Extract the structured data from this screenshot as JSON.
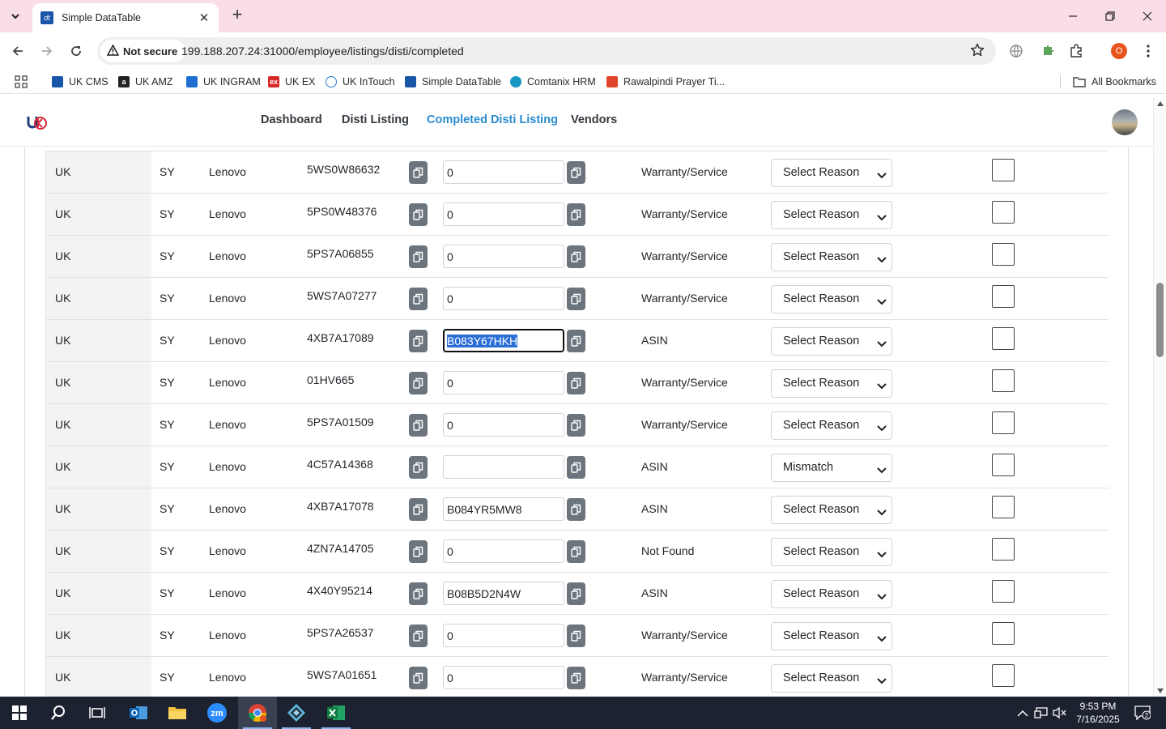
{
  "browser": {
    "tab_title": "Simple DataTable",
    "security_label": "Not secure",
    "url": "199.188.207.24:31000/employee/listings/disti/completed",
    "profile_initial": "O"
  },
  "bookmarks": [
    {
      "label": "UK CMS",
      "color": "#1a56a8",
      "icon": "uk-cms-icon"
    },
    {
      "label": "UK AMZ",
      "color": "#222222",
      "icon": "amazon-icon"
    },
    {
      "label": "UK INGRAM",
      "color": "#1f6fd1",
      "icon": "ingram-icon"
    },
    {
      "label": "UK EX",
      "color": "#d62828",
      "icon": "ex-icon"
    },
    {
      "label": "UK InTouch",
      "color": "#2a7bd3",
      "icon": "intouch-icon"
    },
    {
      "label": "Simple DataTable",
      "color": "#1a56a8",
      "icon": "datatable-icon"
    },
    {
      "label": "Comtanix HRM",
      "color": "#1596c2",
      "icon": "hrm-icon"
    },
    {
      "label": "Rawalpindi Prayer Ti...",
      "color": "#e0452b",
      "icon": "prayer-icon"
    }
  ],
  "all_bookmarks_label": "All Bookmarks",
  "site_nav": {
    "links": [
      {
        "label": "Dashboard",
        "active": false
      },
      {
        "label": "Disti Listing",
        "active": false
      },
      {
        "label": "Completed Disti Listing",
        "active": true
      },
      {
        "label": "Vendors",
        "active": false
      }
    ]
  },
  "rows": [
    {
      "region": "UK",
      "code": "SY",
      "brand": "Lenovo",
      "part": "5WS0W86632",
      "asin": "0",
      "type": "Warranty/Service",
      "reason": "Select Reason"
    },
    {
      "region": "UK",
      "code": "SY",
      "brand": "Lenovo",
      "part": "5PS0W48376",
      "asin": "0",
      "type": "Warranty/Service",
      "reason": "Select Reason"
    },
    {
      "region": "UK",
      "code": "SY",
      "brand": "Lenovo",
      "part": "5PS7A06855",
      "asin": "0",
      "type": "Warranty/Service",
      "reason": "Select Reason"
    },
    {
      "region": "UK",
      "code": "SY",
      "brand": "Lenovo",
      "part": "5WS7A07277",
      "asin": "0",
      "type": "Warranty/Service",
      "reason": "Select Reason"
    },
    {
      "region": "UK",
      "code": "SY",
      "brand": "Lenovo",
      "part": "4XB7A17089",
      "asin": "B083Y67HKH",
      "type": "ASIN",
      "reason": "Select Reason",
      "focused": true
    },
    {
      "region": "UK",
      "code": "SY",
      "brand": "Lenovo",
      "part": "01HV665",
      "asin": "0",
      "type": "Warranty/Service",
      "reason": "Select Reason"
    },
    {
      "region": "UK",
      "code": "SY",
      "brand": "Lenovo",
      "part": "5PS7A01509",
      "asin": "0",
      "type": "Warranty/Service",
      "reason": "Select Reason"
    },
    {
      "region": "UK",
      "code": "SY",
      "brand": "Lenovo",
      "part": "4C57A14368",
      "asin": "",
      "type": "ASIN",
      "reason": "Mismatch"
    },
    {
      "region": "UK",
      "code": "SY",
      "brand": "Lenovo",
      "part": "4XB7A17078",
      "asin": "B084YR5MW8",
      "type": "ASIN",
      "reason": "Select Reason"
    },
    {
      "region": "UK",
      "code": "SY",
      "brand": "Lenovo",
      "part": "4ZN7A14705",
      "asin": "0",
      "type": "Not Found",
      "reason": "Select Reason"
    },
    {
      "region": "UK",
      "code": "SY",
      "brand": "Lenovo",
      "part": "4X40Y95214",
      "asin": "B08B5D2N4W",
      "type": "ASIN",
      "reason": "Select Reason"
    },
    {
      "region": "UK",
      "code": "SY",
      "brand": "Lenovo",
      "part": "5PS7A26537",
      "asin": "0",
      "type": "Warranty/Service",
      "reason": "Select Reason"
    },
    {
      "region": "UK",
      "code": "SY",
      "brand": "Lenovo",
      "part": "5WS7A01651",
      "asin": "0",
      "type": "Warranty/Service",
      "reason": "Select Reason"
    }
  ],
  "taskbar": {
    "apps": [
      "start-icon",
      "search-icon",
      "task-view-icon",
      "outlook-icon",
      "file-explorer-icon",
      "zoom-icon",
      "chrome-icon",
      "app-icon",
      "excel-icon"
    ],
    "time": "9:53 PM",
    "date": "7/16/2025",
    "notification_count": "2"
  },
  "colors": {
    "tabstrip": "#f9dde9",
    "active_nav": "#2a8bd0",
    "copy_button": "#6c757d",
    "taskbar": "#1c2230"
  }
}
